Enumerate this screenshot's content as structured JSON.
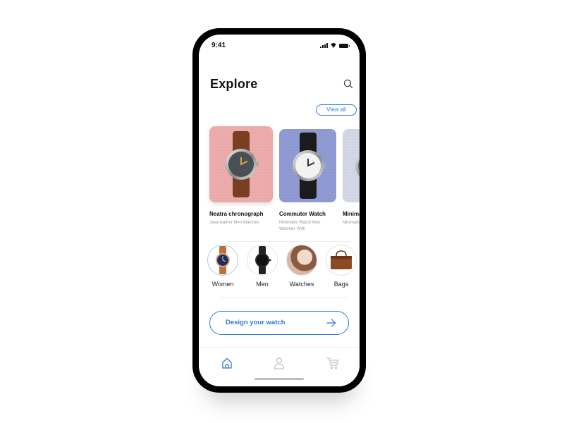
{
  "status_bar": {
    "time": "9:41",
    "icons": [
      "signal-icon",
      "wifi-icon",
      "battery-icon"
    ]
  },
  "header": {
    "title": "Explore",
    "search_icon": "search-icon"
  },
  "view_all_label": "View all",
  "products": [
    {
      "name": "Neatra chronograph",
      "description": "Java leather Men Watches",
      "card_color": "#eeadad",
      "strap_color": "#7a3f22",
      "dial_color": "#4a4f55"
    },
    {
      "name": "Commuter Watch",
      "description": "Minimalist Watch Men Watches With",
      "card_color": "#8e9bd4",
      "strap_color": "#1b1b1b",
      "dial_color": "#f2f2f2"
    },
    {
      "name": "Minimalist",
      "description": "Minimalist Men Watches",
      "card_color": "#d3d9e6",
      "strap_color": "#3a3a3a",
      "dial_color": "#6b6b6b"
    }
  ],
  "categories": [
    {
      "label": "Women",
      "icon": "women-watch-icon",
      "active": true
    },
    {
      "label": "Men",
      "icon": "men-watch-icon",
      "active": false
    },
    {
      "label": "Watches",
      "icon": "watches-photo-icon",
      "active": false
    },
    {
      "label": "Bags",
      "icon": "bag-icon",
      "active": false
    }
  ],
  "cta": {
    "label": "Design your watch",
    "icon": "arrow-right-icon"
  },
  "tabbar": {
    "tabs": [
      {
        "name": "home",
        "icon": "home-icon",
        "active": true
      },
      {
        "name": "profile",
        "icon": "user-icon",
        "active": false
      },
      {
        "name": "cart",
        "icon": "cart-icon",
        "active": false
      }
    ]
  },
  "colors": {
    "accent": "#2e7bcf",
    "text": "#111111",
    "muted": "#9a9a9a",
    "inactive_icon": "#c4c4c4"
  }
}
